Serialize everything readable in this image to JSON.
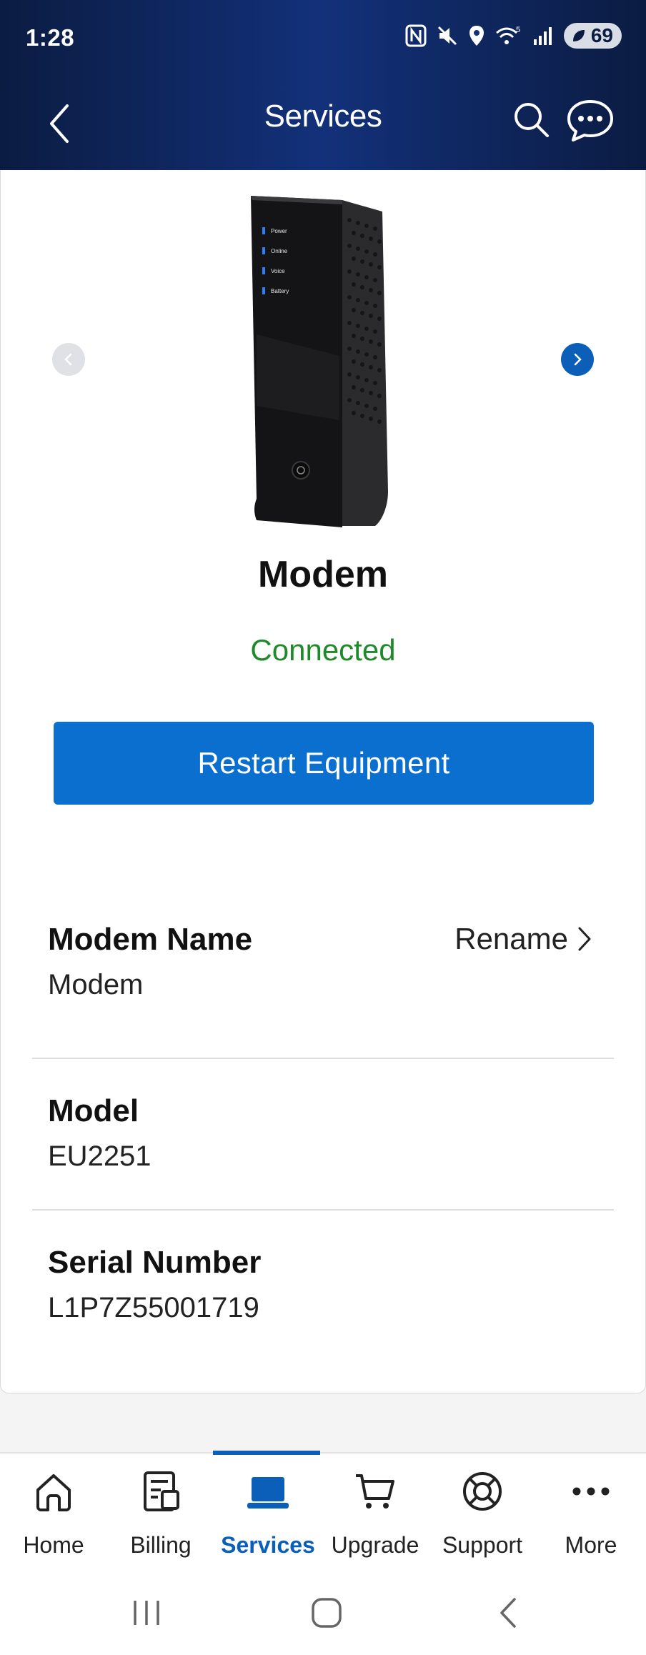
{
  "status_bar": {
    "time": "1:28",
    "battery": "69"
  },
  "header": {
    "title": "Services"
  },
  "device": {
    "title": "Modem",
    "status": "Connected",
    "status_color": "#1f8a2a",
    "modem_leds": [
      "Power",
      "Online",
      "Voice",
      "Battery"
    ]
  },
  "actions": {
    "restart_label": "Restart Equipment"
  },
  "details": {
    "name_label": "Modem Name",
    "name_value": "Modem",
    "rename_label": "Rename",
    "model_label": "Model",
    "model_value": "EU2251",
    "serial_label": "Serial Number",
    "serial_value": "L1P7Z55001719"
  },
  "tabs": [
    {
      "label": "Home",
      "icon": "home-icon"
    },
    {
      "label": "Billing",
      "icon": "bill-icon"
    },
    {
      "label": "Services",
      "icon": "laptop-icon",
      "active": true
    },
    {
      "label": "Upgrade",
      "icon": "cart-icon"
    },
    {
      "label": "Support",
      "icon": "lifebuoy-icon"
    },
    {
      "label": "More",
      "icon": "more-dots-icon"
    }
  ],
  "colors": {
    "header_dark": "#0b1c42",
    "accent_blue": "#0b6fd0",
    "active_tab": "#0b5fb8"
  }
}
